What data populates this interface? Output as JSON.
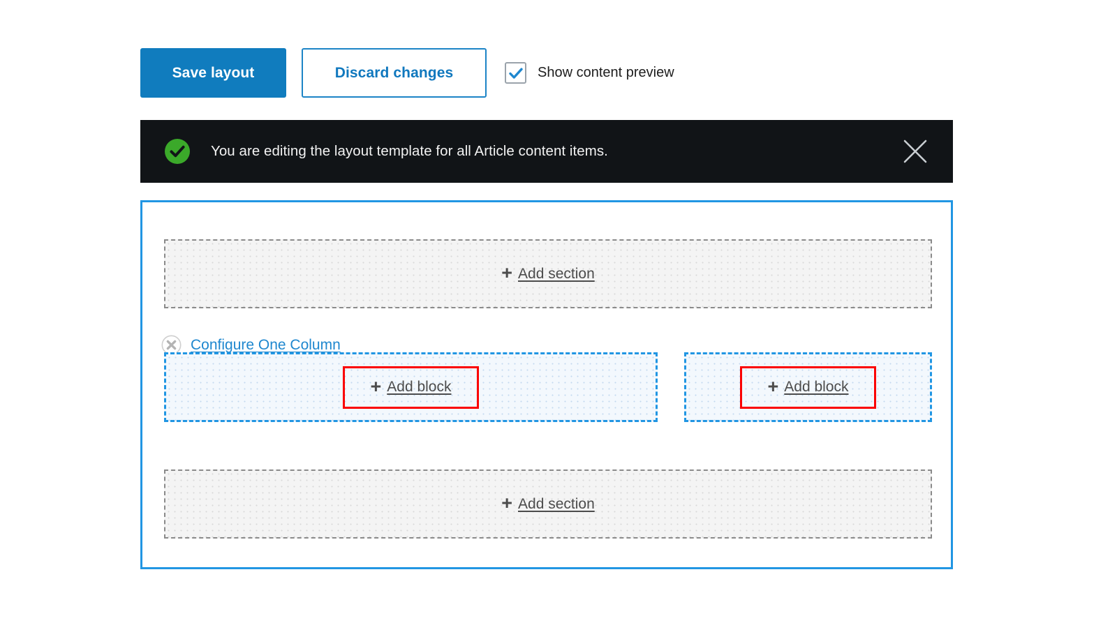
{
  "toolbar": {
    "save_label": "Save layout",
    "discard_label": "Discard changes",
    "preview_checkbox_label": "Show content preview",
    "preview_checked": true
  },
  "banner": {
    "message": "You are editing the layout template for all Article content items.",
    "status_icon": "check-circle-icon",
    "close_icon": "close-icon",
    "background_color": "#111417",
    "status_color": "#3ba92a"
  },
  "layout": {
    "accent_color": "#2196e3",
    "highlight_color": "#fb0000",
    "sections": [
      {
        "plus": "+",
        "label": "Add section"
      },
      {
        "plus": "+",
        "label": "Add section"
      }
    ],
    "region_group": {
      "remove_icon": "remove-circle-icon",
      "configure_label": "Configure One Column",
      "regions": [
        {
          "plus": "+",
          "label": "Add block",
          "highlighted": true
        },
        {
          "plus": "+",
          "label": "Add block",
          "highlighted": true
        }
      ]
    }
  }
}
